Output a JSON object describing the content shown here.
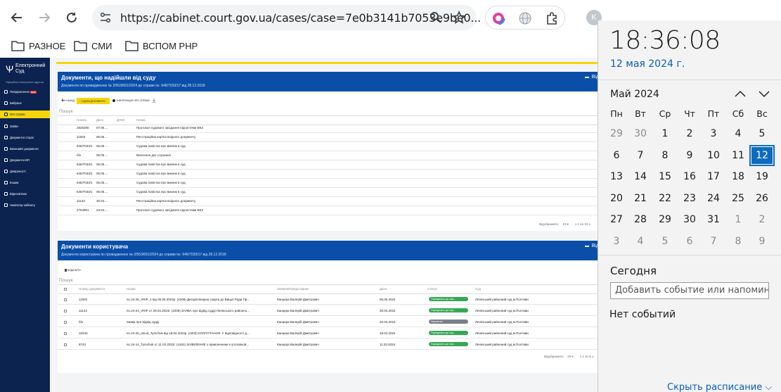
{
  "browser": {
    "url": "https://cabinet.court.gov.ua/cases/case=7e0b3141b7053e9be0...",
    "profile_initial": "K",
    "bookmarks": [
      "РАЗНОЕ",
      "СМИ",
      "ВСПОМ РНР"
    ]
  },
  "site": {
    "logo_line1": "Електронний",
    "logo_line2": "Суд",
    "logo_tagline": "Офіційна електронна адреса",
    "nav": [
      {
        "label": "Повідомлення",
        "badge": "NEW"
      },
      {
        "label": "Вибране"
      },
      {
        "label": "Мої справи"
      },
      {
        "label": "Заяви"
      },
      {
        "label": "Документи сторін"
      },
      {
        "label": "Виконавчі документи"
      },
      {
        "label": "Документи ВП"
      },
      {
        "label": "Довіреності"
      },
      {
        "label": "Кошик"
      },
      {
        "label": "Відеозв'язок"
      },
      {
        "label": "Навігатор кабінету"
      }
    ]
  },
  "panel1": {
    "title": "Документи, що надійшли від суду",
    "subtitle": "Документи по провадженню № 2/553/691/2024 до справи №: 646/7033/17 від 28.12.2018",
    "right_label": "Від",
    "back_label": "НАЗАД",
    "btn_label": "СУДОВІ ДОКУМЕНТИ",
    "info_label": "ІНФОРМАЦІЯ ПРО СПРАВУ",
    "search": "Пошук",
    "columns": [
      "Номер...",
      "Дата",
      "ДЛЗС",
      "Назва"
    ],
    "rows": [
      [
        "2826290",
        "07.05....",
        "",
        "Протокол судового засідання підсистеми ВКЗ"
      ],
      [
        "11503",
        "06.05....",
        "",
        "Реєстраційна картка вхідного документу"
      ],
      [
        "646/7033/1",
        "06.05....",
        "",
        "Судова повістка про виклик в суд"
      ],
      [
        "б/н",
        "06.05....",
        "",
        "Внесення дат слухання"
      ],
      [
        "646/7033/1",
        "06.05....",
        "",
        "Судова повістка про виклик в суд"
      ],
      [
        "646/7033/1",
        "06.05....",
        "",
        "Судова повістка про виклик в суд"
      ],
      [
        "646/7033/1",
        "06.05....",
        "",
        "Судова повістка про виклик в суд"
      ],
      [
        "646/7033/1",
        "06.05....",
        "",
        "Судова повістка про виклик в суд"
      ],
      [
        "11134",
        "30.04....",
        "",
        "Реєстраційна картка вхідного документу"
      ],
      [
        "2764901",
        "23.04....",
        "",
        "Протокол судового засідання підсистеми ВКЗ"
      ]
    ],
    "pager_label": "Відображати:",
    "pager_size": "10",
    "pager_range": "з 1 по 10 з"
  },
  "panel2": {
    "title": "Документи користувача",
    "subtitle": "Документи користувача по провадженню № 2/553/691/2024 до справи №: 646/7033/17 від 28.12.2018",
    "right_label": "Від",
    "action_label": "ВИДАЛИТИ",
    "search": "Пошук",
    "columns": [
      "Номер документа",
      "Назва",
      "Заявник/Представник",
      "Дата",
      "Статус",
      "Суд"
    ],
    "rows": [
      {
        "num": "11503",
        "name": "по.24-25_VRIP_1 від 05.05.2024р. (4208) Дисциплінарна скарга до Вищої Ради Пр...",
        "applicant": "Канцера Валерій Дмитрович",
        "date": "06.05.2024",
        "status": "Приєднано до спр...",
        "status_color": "#34a853",
        "court": "Ленінський районний суд м.Полтави"
      },
      {
        "num": "11134",
        "name": "по.24-24_VRIP от 29.04.2024г. (4206) ЗАЯВА про відвід судді Ленінського районно...",
        "applicant": "Канцера Валерій Дмитрович",
        "date": "30.04.2024",
        "status": "Приєднано до спр...",
        "status_color": "#34a853",
        "court": "Ленінський районний суд м.Полтави"
      },
      {
        "num": "б/н",
        "name": "Заява про відвід судді",
        "applicant": "Канцера Валерій Дмитрович",
        "date": "20.04.2024",
        "status": "Чернетка",
        "status_color": "#7b8088",
        "court": "Ленінський районний суд м.Полтави"
      },
      {
        "num": "10343",
        "name": "по.24-20_otvod_Tymchuk від 18.04.2024р. (4202) КЛОПОТАННЯ. У відповідності д...",
        "applicant": "Канцера Валерій Дмитрович",
        "date": "18.04.2024",
        "status": "Приєднано до спр...",
        "status_color": "#34a853",
        "court": "Ленінський районний суд м.Полтави"
      },
      {
        "num": "8743",
        "name": "по.24-14_Tymchuk от 11.03.2022г. (4191) ЗАЯВЛЕНИЕ о привлечении к уголовной...",
        "applicant": "Канцера Валерій Дмитрович",
        "date": "11.03.2024",
        "status": "Приєднано до спр...",
        "status_color": "#34a853",
        "court": "Ленінський районний суд м.Полтави"
      }
    ],
    "pager_label": "Відображати:",
    "pager_size": "20",
    "pager_range": "з 1 по 5 з"
  },
  "calendar": {
    "time": "18:36:08",
    "date": "12 мая 2024 г.",
    "month": "Май 2024",
    "weekdays": [
      "Пн",
      "Вт",
      "Ср",
      "Чт",
      "Пт",
      "Сб",
      "Вс"
    ],
    "weeks": [
      [
        "29",
        "30",
        "1",
        "2",
        "3",
        "4",
        "5"
      ],
      [
        "6",
        "7",
        "8",
        "9",
        "10",
        "11",
        "12"
      ],
      [
        "13",
        "14",
        "15",
        "16",
        "17",
        "18",
        "19"
      ],
      [
        "20",
        "21",
        "22",
        "23",
        "24",
        "25",
        "26"
      ],
      [
        "27",
        "28",
        "29",
        "30",
        "31",
        "1",
        "2"
      ],
      [
        "3",
        "4",
        "5",
        "6",
        "7",
        "8",
        "9"
      ]
    ],
    "today_label": "Сегодня",
    "add_event_placeholder": "Добавить событие или напоминан",
    "no_events": "Нет событий",
    "hide_schedule": "Скрыть расписание"
  }
}
